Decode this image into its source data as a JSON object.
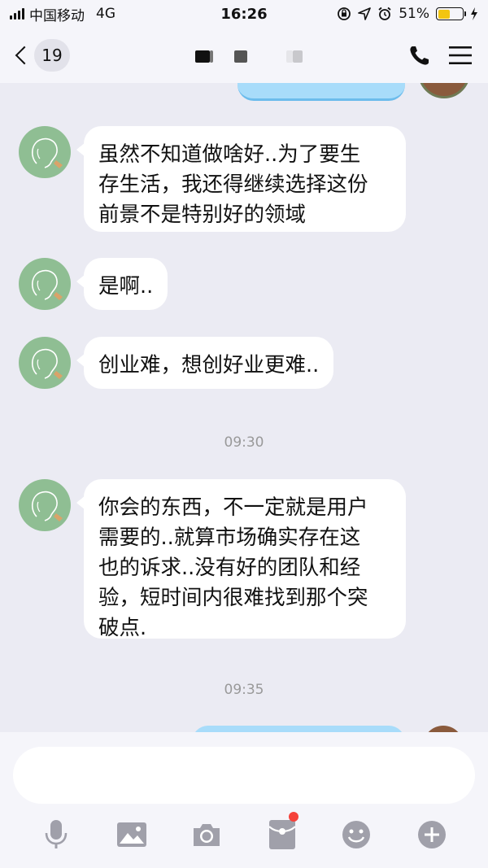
{
  "status_bar": {
    "carrier": "中国移动",
    "network": "4G",
    "time": "16:26",
    "battery_percent": "51%",
    "battery_level": 0.51
  },
  "nav": {
    "unread_count": "19"
  },
  "messages": [
    {
      "text": "虽然不知道做啥好..为了要生\n存生活，我还得继续选择这份\n前景不是特别好的领域"
    },
    {
      "text": "是啊.."
    },
    {
      "text": "创业难，想创好业更难.."
    },
    {
      "text": "你会的东西，不一定就是用户\n需要的..就算市场确实存在这\n也的诉求..没有好的团队和经\n验，短时间内很难找到那个突\n破点."
    }
  ],
  "timestamps": [
    "09:30",
    "09:35"
  ],
  "input": {
    "value": "",
    "placeholder": ""
  },
  "toolbar": {
    "items": [
      "microphone-icon",
      "image-icon",
      "camera-icon",
      "red-packet-icon",
      "emoji-icon",
      "plus-icon"
    ],
    "red_packet_has_notification": true
  },
  "colors": {
    "background": "#ebebf3",
    "bubble_incoming": "#ffffff",
    "bubble_outgoing": "#a8dcfa",
    "avatar": "#8fbe93",
    "icon_gray": "#a0a0aa",
    "notification_red": "#f5413a",
    "battery_yellow": "#f2c511"
  }
}
